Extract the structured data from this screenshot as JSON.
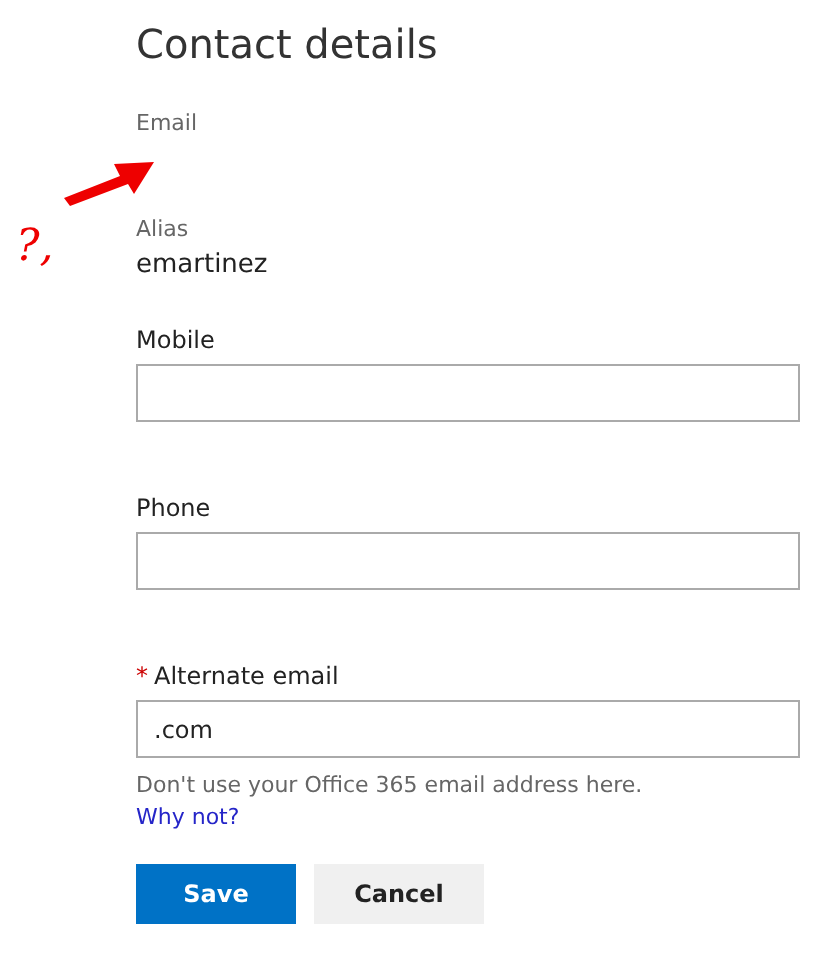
{
  "title": "Contact details",
  "email": {
    "label": "Email"
  },
  "annotation": {
    "text": "?,"
  },
  "alias": {
    "label": "Alias",
    "value": "emartinez"
  },
  "fields": [
    {
      "label": "Mobile"
    },
    {
      "label": "Phone"
    },
    {
      "label": "Alternate email",
      "required_mark": "*",
      "value": ".com"
    }
  ],
  "help_text": "Don't use your Office 365 email address here.",
  "help_link": "Why not?",
  "buttons": [
    {
      "label": "Save",
      "kind": "primary"
    },
    {
      "label": "Cancel",
      "kind": "secondary"
    }
  ]
}
